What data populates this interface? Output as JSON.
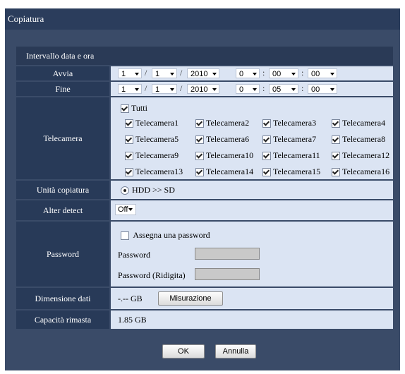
{
  "window": {
    "title": "Copiatura"
  },
  "section": {
    "title": "Intervallo data e ora"
  },
  "start": {
    "label": "Avvia",
    "month": "1",
    "day": "1",
    "year": "2010",
    "hour": "0",
    "minute": "00",
    "second": "00",
    "date_sep": "/",
    "time_sep": ":"
  },
  "end": {
    "label": "Fine",
    "month": "1",
    "day": "1",
    "year": "2010",
    "hour": "0",
    "minute": "05",
    "second": "00",
    "date_sep": "/",
    "time_sep": ":"
  },
  "cameras": {
    "label": "Telecamera",
    "all_label": "Tutti",
    "items": [
      {
        "name": "Telecamera1",
        "checked": true
      },
      {
        "name": "Telecamera2",
        "checked": true
      },
      {
        "name": "Telecamera3",
        "checked": true
      },
      {
        "name": "Telecamera4",
        "checked": true
      },
      {
        "name": "Telecamera5",
        "checked": true
      },
      {
        "name": "Telecamera6",
        "checked": true
      },
      {
        "name": "Telecamera7",
        "checked": true
      },
      {
        "name": "Telecamera8",
        "checked": true
      },
      {
        "name": "Telecamera9",
        "checked": true
      },
      {
        "name": "Telecamera10",
        "checked": true
      },
      {
        "name": "Telecamera11",
        "checked": true
      },
      {
        "name": "Telecamera12",
        "checked": true
      },
      {
        "name": "Telecamera13",
        "checked": true
      },
      {
        "name": "Telecamera14",
        "checked": true
      },
      {
        "name": "Telecamera15",
        "checked": true
      },
      {
        "name": "Telecamera16",
        "checked": true
      }
    ]
  },
  "copy_unit": {
    "label": "Unità copiatura",
    "option": "HDD >> SD"
  },
  "alter_detect": {
    "label": "Alter detect",
    "value": "Off"
  },
  "password": {
    "label": "Password",
    "assign_label": "Assegna una password",
    "field_label": "Password",
    "confirm_label": "Password (Ridigita)"
  },
  "data_size": {
    "label": "Dimensione dati",
    "value": "-.-- GB",
    "button": "Misurazione"
  },
  "remaining": {
    "label": "Capacità rimasta",
    "value": "1.85 GB"
  },
  "buttons": {
    "ok": "OK",
    "cancel": "Annulla"
  }
}
